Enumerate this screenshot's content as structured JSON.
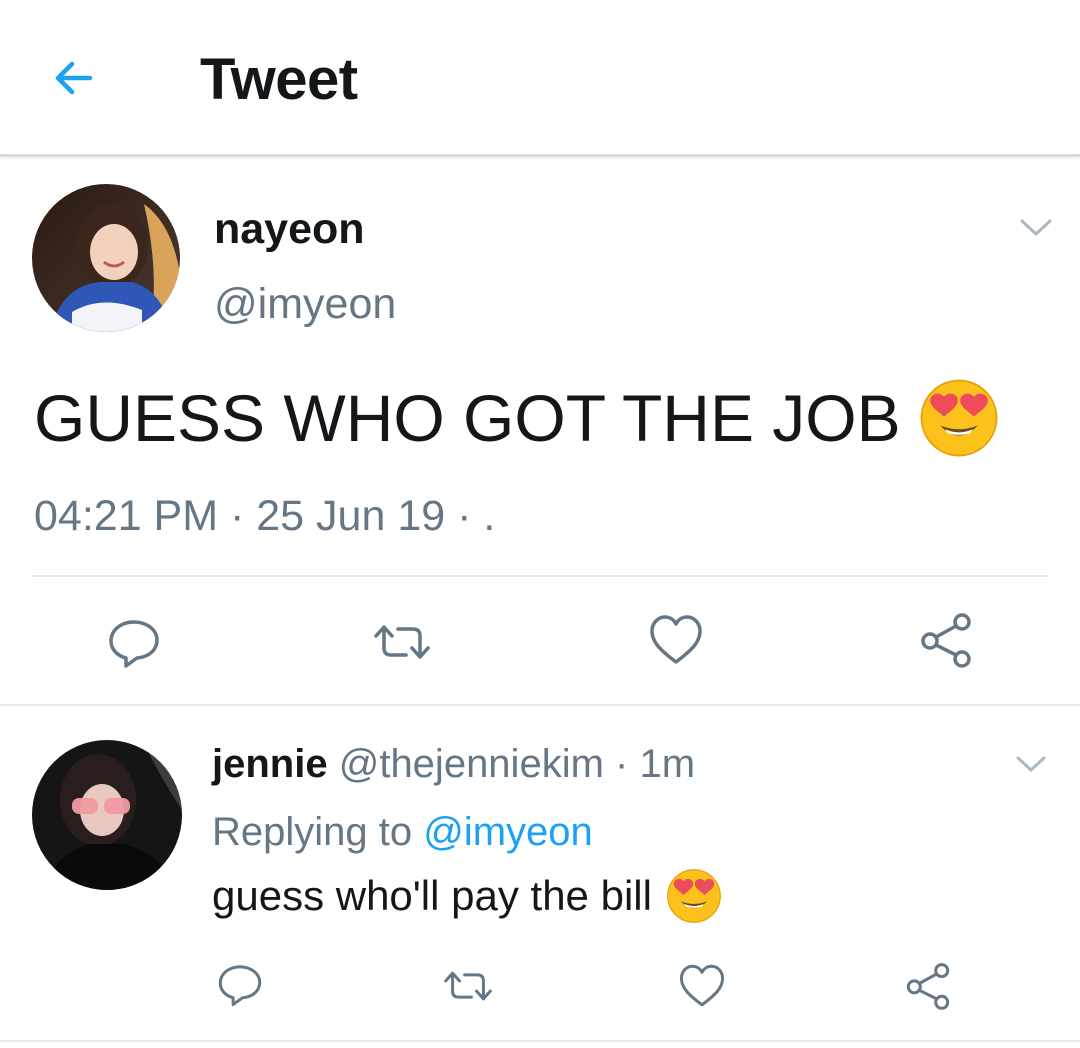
{
  "header": {
    "title": "Tweet",
    "back_icon": "arrow-left-icon"
  },
  "colors": {
    "accent": "#1da1f2",
    "text": "#14171a",
    "muted": "#657786",
    "divider": "#e1e8ed"
  },
  "main_tweet": {
    "display_name": "nayeon",
    "handle": "@imyeon",
    "text": "GUESS WHO GOT THE JOB",
    "emoji": "heart-eyes-emoji",
    "timestamp": "04:21 PM · 25 Jun 19 · .",
    "menu_icon": "chevron-down-icon",
    "actions": [
      "reply-icon",
      "retweet-icon",
      "like-icon",
      "share-icon"
    ]
  },
  "reply_tweet": {
    "display_name": "jennie",
    "handle_time": "@thejenniekim · 1m",
    "replying_prefix": "Replying to ",
    "replying_handle": "@imyeon",
    "text": "guess who'll pay the bill",
    "emoji": "heart-eyes-emoji",
    "menu_icon": "chevron-down-icon",
    "actions": [
      "reply-icon",
      "retweet-icon",
      "like-icon",
      "share-icon"
    ]
  }
}
